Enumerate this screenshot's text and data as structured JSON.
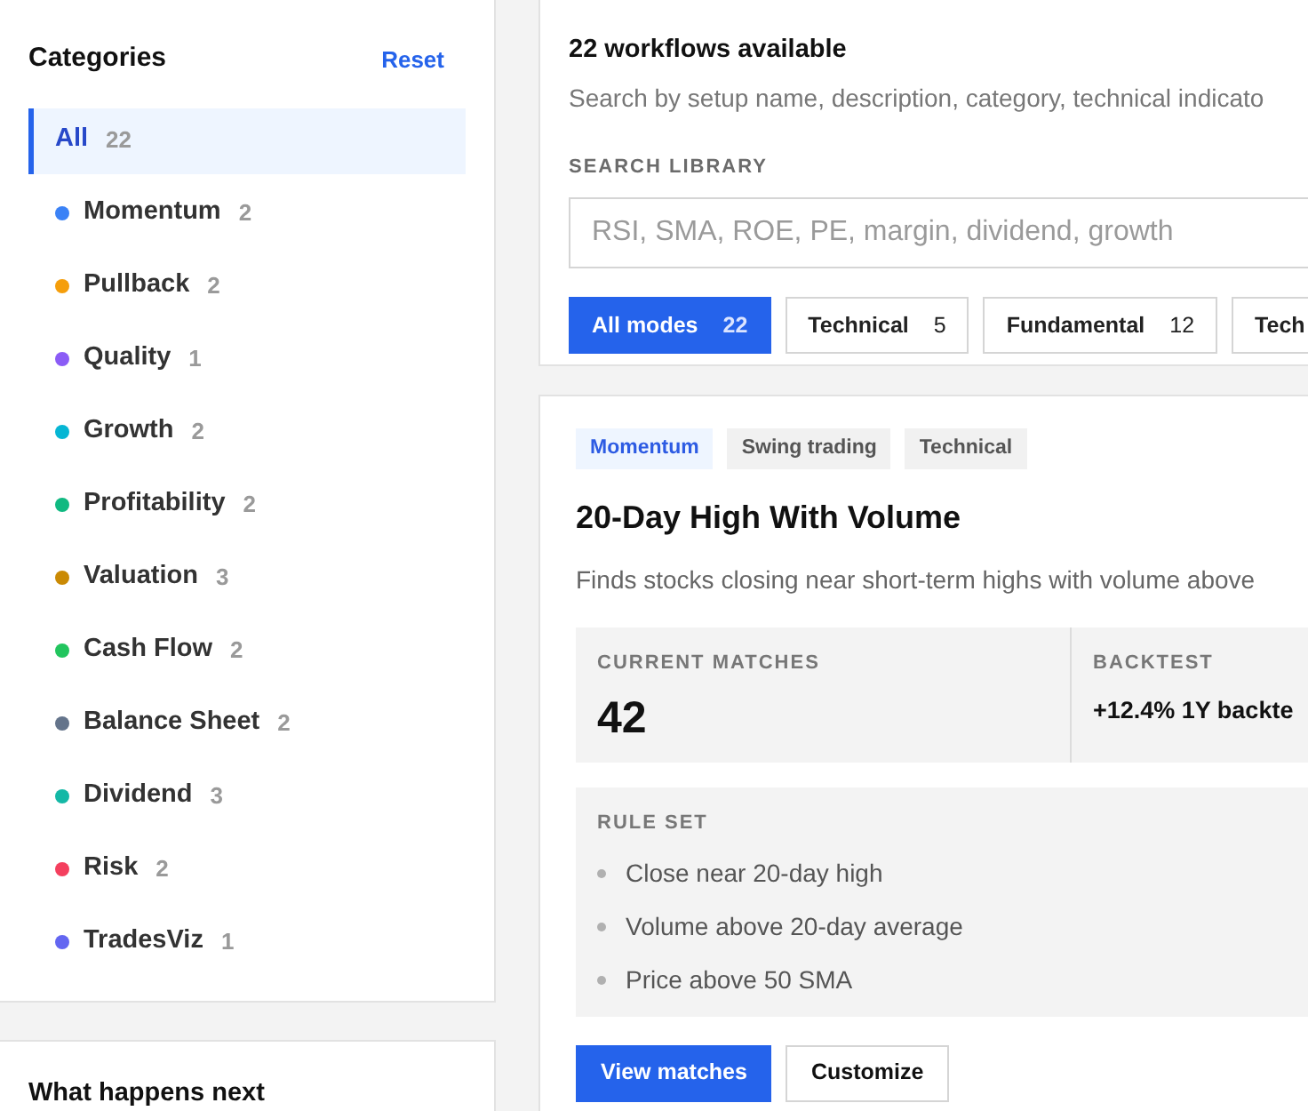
{
  "sidebar": {
    "title": "Categories",
    "reset": "Reset",
    "items": [
      {
        "label": "All",
        "count": "22",
        "selected": true
      },
      {
        "label": "Momentum",
        "count": "2",
        "color": "#3b82f6",
        "selected": false
      },
      {
        "label": "Pullback",
        "count": "2",
        "color": "#f59e0b",
        "selected": false
      },
      {
        "label": "Quality",
        "count": "1",
        "color": "#8b5cf6",
        "selected": false
      },
      {
        "label": "Growth",
        "count": "2",
        "color": "#06b6d4",
        "selected": false
      },
      {
        "label": "Profitability",
        "count": "2",
        "color": "#10b981",
        "selected": false
      },
      {
        "label": "Valuation",
        "count": "3",
        "color": "#ca8a04",
        "selected": false
      },
      {
        "label": "Cash Flow",
        "count": "2",
        "color": "#22c55e",
        "selected": false
      },
      {
        "label": "Balance Sheet",
        "count": "2",
        "color": "#64748b",
        "selected": false
      },
      {
        "label": "Dividend",
        "count": "3",
        "color": "#14b8a6",
        "selected": false
      },
      {
        "label": "Risk",
        "count": "2",
        "color": "#f43f5e",
        "selected": false
      },
      {
        "label": "TradesViz",
        "count": "1",
        "color": "#6366f1",
        "selected": false
      }
    ]
  },
  "next_panel": {
    "title": "What happens next"
  },
  "library": {
    "heading": "22 workflows available",
    "subtitle": "Search by setup name, description, category, technical indicato",
    "search_label": "SEARCH LIBRARY",
    "placeholder": "RSI, SMA, ROE, PE, margin, dividend, growth",
    "modes": [
      {
        "label": "All modes",
        "count": "22",
        "selected": true
      },
      {
        "label": "Technical",
        "count": "5",
        "selected": false
      },
      {
        "label": "Fundamental",
        "count": "12",
        "selected": false
      },
      {
        "label": "Tech",
        "selected": false
      }
    ]
  },
  "workflow": {
    "tags": [
      {
        "label": "Momentum",
        "kind": "category"
      },
      {
        "label": "Swing trading",
        "kind": "plain"
      },
      {
        "label": "Technical",
        "kind": "plain"
      }
    ],
    "title": "20-Day High With Volume",
    "description": "Finds stocks closing near short-term highs with volume above",
    "stats": [
      {
        "label": "CURRENT MATCHES",
        "value": "42",
        "kind": "big"
      },
      {
        "label": "BACKTEST",
        "value": "+12.4% 1Y backte",
        "kind": "text"
      }
    ],
    "rules_label": "RULE SET",
    "rules": [
      "Close near 20-day high",
      "Volume above 20-day average",
      "Price above 50 SMA"
    ],
    "buttons": [
      {
        "label": "View matches",
        "kind": "primary"
      },
      {
        "label": "Customize",
        "kind": "outline"
      }
    ]
  }
}
